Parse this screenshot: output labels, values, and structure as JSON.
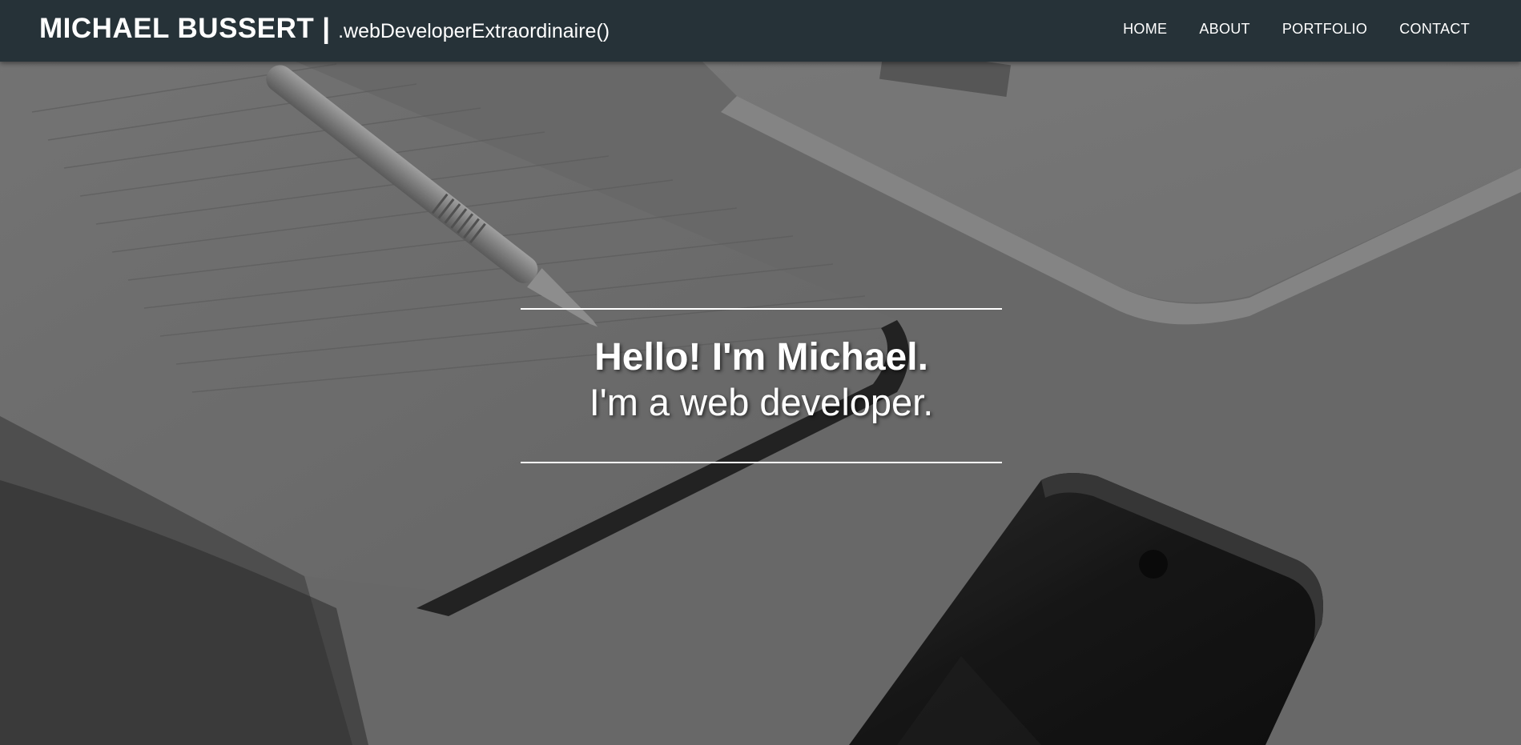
{
  "header": {
    "brand_name": "MICHAEL BUSSERT",
    "brand_separator": "|",
    "brand_tagline": ".webDeveloperExtraordinaire()",
    "background_color": "#263238",
    "nav": [
      {
        "label": "HOME"
      },
      {
        "label": "ABOUT"
      },
      {
        "label": "PORTFOLIO"
      },
      {
        "label": "CONTACT"
      }
    ]
  },
  "hero": {
    "headline": "Hello! I'm Michael.",
    "subheadline": "I'm a web developer."
  }
}
